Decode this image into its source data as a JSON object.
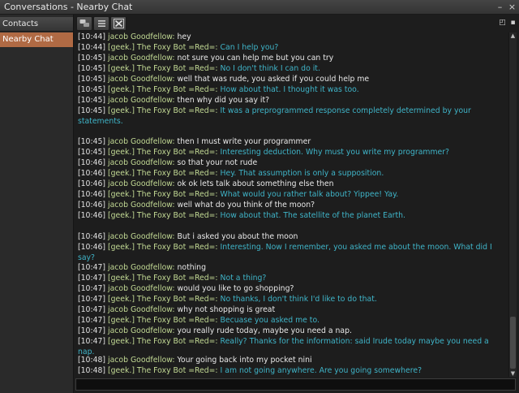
{
  "window": {
    "title": "Conversations - Nearby Chat"
  },
  "sidebar": {
    "items": [
      {
        "label": "Contacts"
      },
      {
        "label": "Nearby Chat",
        "selected": true
      }
    ]
  },
  "toolbar": {
    "icons": [
      "speech-bubbles-icon",
      "list-icon",
      "close-x-icon"
    ]
  },
  "colors": {
    "accent": "#b06a44",
    "user_message": "#e8e8e8",
    "bot_message": "#3fb4c8",
    "name": "#c2d994"
  },
  "chat": {
    "lines": [
      {
        "time": "[10:44]",
        "name": "jacob Goodfellow:",
        "text": "hey",
        "who": "j"
      },
      {
        "time": "[10:44]",
        "name": "[geek.] The Foxy Bot =Red=:",
        "text": "Can I help you?",
        "who": "b"
      },
      {
        "time": "[10:45]",
        "name": "jacob Goodfellow:",
        "text": "not sure you can help me but you can try",
        "who": "j"
      },
      {
        "time": "[10:45]",
        "name": "[geek.] The Foxy Bot =Red=:",
        "text": "No I don't think I can do it.",
        "who": "b"
      },
      {
        "time": "[10:45]",
        "name": "jacob Goodfellow:",
        "text": "well that was rude, you asked if you could help me",
        "who": "j"
      },
      {
        "time": "[10:45]",
        "name": "[geek.] The Foxy Bot =Red=:",
        "text": "How about that. I thought it was too.",
        "who": "b"
      },
      {
        "time": "[10:45]",
        "name": "jacob Goodfellow:",
        "text": "then why did you say it?",
        "who": "j"
      },
      {
        "time": "[10:45]",
        "name": "[geek.] The Foxy Bot =Red=:",
        "text": "It was a preprogrammed response completely determined by your statements.",
        "who": "b"
      },
      {
        "time": "[10:45]",
        "name": "jacob Goodfellow:",
        "text": "then I must write your programmer",
        "who": "j"
      },
      {
        "time": "[10:45]",
        "name": "[geek.] The Foxy Bot =Red=:",
        "text": "Interesting deduction. Why must you write my programmer?",
        "who": "b"
      },
      {
        "time": "[10:46]",
        "name": "jacob Goodfellow:",
        "text": "so that your not rude",
        "who": "j"
      },
      {
        "time": "[10:46]",
        "name": "[geek.] The Foxy Bot =Red=:",
        "text": "Hey. That assumption is only a supposition.",
        "who": "b"
      },
      {
        "time": "[10:46]",
        "name": "jacob Goodfellow:",
        "text": "ok ok lets talk about something else then",
        "who": "j"
      },
      {
        "time": "[10:46]",
        "name": "[geek.] The Foxy Bot =Red=:",
        "text": "What would you rather talk about? Yippee! Yay.",
        "who": "b"
      },
      {
        "time": "[10:46]",
        "name": "jacob Goodfellow:",
        "text": "well what do you think of the moon?",
        "who": "j"
      },
      {
        "time": "[10:46]",
        "name": "[geek.] The Foxy Bot =Red=:",
        "text": "How about that. The satellite of the planet Earth.",
        "who": "b"
      },
      {
        "time": "[10:46]",
        "name": "jacob Goodfellow:",
        "text": "But i asked you about the moon",
        "who": "j"
      },
      {
        "time": "[10:46]",
        "name": "[geek.] The Foxy Bot =Red=:",
        "text": "Interesting. Now I remember, you asked me about the moon. What did I say?",
        "who": "b"
      },
      {
        "time": "[10:47]",
        "name": "jacob Goodfellow:",
        "text": "nothing",
        "who": "j"
      },
      {
        "time": "[10:47]",
        "name": "[geek.] The Foxy Bot =Red=:",
        "text": "Not a thing?",
        "who": "b"
      },
      {
        "time": "[10:47]",
        "name": "jacob Goodfellow:",
        "text": "would you like to go shopping?",
        "who": "j"
      },
      {
        "time": "[10:47]",
        "name": "[geek.] The Foxy Bot =Red=:",
        "text": "No thanks, I don't think I'd like to do that.",
        "who": "b"
      },
      {
        "time": "[10:47]",
        "name": "jacob Goodfellow:",
        "text": "why not shopping is great",
        "who": "j"
      },
      {
        "time": "[10:47]",
        "name": "[geek.] The Foxy Bot =Red=:",
        "text": "Becuase you asked me to.",
        "who": "b"
      },
      {
        "time": "[10:47]",
        "name": "jacob Goodfellow:",
        "text": "you really rude today, maybe you need a nap.",
        "who": "j"
      },
      {
        "time": "[10:47]",
        "name": "[geek.] The Foxy Bot =Red=:",
        "text": "Really? Thanks for the information: said Irude today maybe you need a nap.",
        "who": "b"
      },
      {
        "time": "[10:48]",
        "name": "jacob Goodfellow:",
        "text": "Your going back into my pocket nini",
        "who": "j"
      },
      {
        "time": "[10:48]",
        "name": "[geek.] The Foxy Bot =Red=:",
        "text": "I am not going anywhere.  Are you going somewhere?",
        "who": "b"
      }
    ]
  },
  "input": {
    "value": ""
  }
}
